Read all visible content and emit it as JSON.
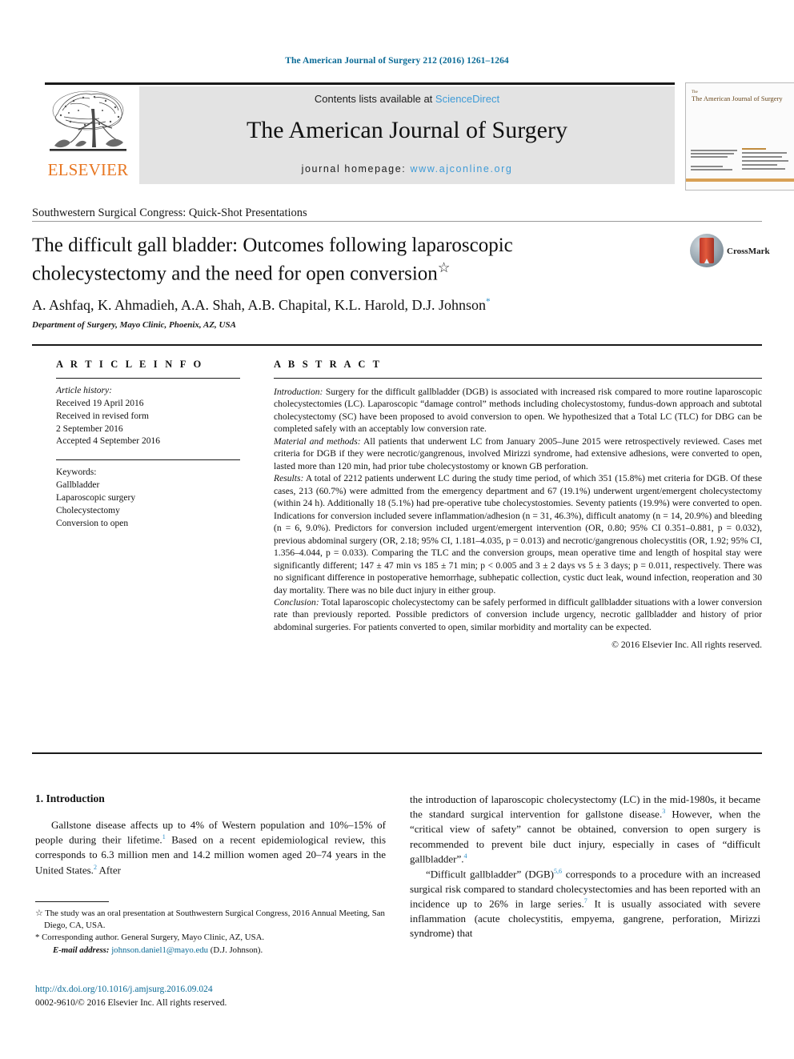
{
  "running_head": "The American Journal of Surgery 212 (2016) 1261–1264",
  "masthead": {
    "contents_prefix": "Contents lists available at ",
    "sciencedirect": "ScienceDirect",
    "journal_name": "The American Journal of Surgery",
    "homepage_prefix": "journal homepage: ",
    "homepage_url": "www.ajconline.org",
    "publisher": "ELSEVIER",
    "cover_title": "The American Journal of Surgery",
    "cover_title_small": "The"
  },
  "colors": {
    "running_head_blue": "#0a6a96",
    "link_blue": "#3f9bd7",
    "elsevier_orange": "#e87722",
    "panel_gray": "#e3e3e3",
    "sup_blue": "#2c8fc9"
  },
  "section_label": "Southwestern Surgical Congress: Quick-Shot Presentations",
  "title": "The difficult gall bladder: Outcomes following laparoscopic cholecystectomy and the need for open conversion",
  "title_marker": "☆",
  "authors": "A. Ashfaq, K. Ahmadieh, A.A. Shah, A.B. Chapital, K.L. Harold, D.J. Johnson",
  "authors_marker": "*",
  "affiliation": "Department of Surgery, Mayo Clinic, Phoenix, AZ, USA",
  "crossmark_label": "CrossMark",
  "article_info": {
    "heading": "A R T I C L E  I N F O",
    "history_label": "Article history:",
    "history": [
      "Received 19 April 2016",
      "Received in revised form",
      "2 September 2016",
      "Accepted 4 September 2016"
    ],
    "keywords_label": "Keywords:",
    "keywords": [
      "Gallbladder",
      "Laparoscopic surgery",
      "Cholecystectomy",
      "Conversion to open"
    ]
  },
  "abstract": {
    "heading": "A B S T R A C T",
    "introduction_label": "Introduction:",
    "introduction": " Surgery for the difficult gallbladder (DGB) is associated with increased risk compared to more routine laparoscopic cholecystectomies (LC). Laparoscopic “damage control” methods including cholecystostomy, fundus-down approach and subtotal cholecystectomy (SC) have been proposed to avoid conversion to open. We hypothesized that a Total LC (TLC) for DBG can be completed safely with an acceptably low conversion rate.",
    "methods_label": "Material and methods:",
    "methods": " All patients that underwent LC from January 2005–June 2015 were retrospectively reviewed. Cases met criteria for DGB if they were necrotic/gangrenous, involved Mirizzi syndrome, had extensive adhesions, were converted to open, lasted more than 120 min, had prior tube cholecystostomy or known GB perforation.",
    "results_label": "Results:",
    "results": " A total of 2212 patients underwent LC during the study time period, of which 351 (15.8%) met criteria for DGB. Of these cases, 213 (60.7%) were admitted from the emergency department and 67 (19.1%) underwent urgent/emergent cholecystectomy (within 24 h). Additionally 18 (5.1%) had pre-operative tube cholecystostomies. Seventy patients (19.9%) were converted to open. Indications for conversion included severe inflammation/adhesion (n = 31, 46.3%), difficult anatomy (n = 14, 20.9%) and bleeding (n = 6, 9.0%). Predictors for conversion included urgent/emergent intervention (OR, 0.80; 95% CI 0.351–0.881, p = 0.032), previous abdominal surgery (OR, 2.18; 95% CI, 1.181–4.035, p = 0.013) and necrotic/gangrenous cholecystitis (OR, 1.92; 95% CI, 1.356–4.044, p = 0.033). Comparing the TLC and the conversion groups, mean operative time and length of hospital stay were significantly different; 147 ± 47 min vs 185 ± 71 min; p < 0.005 and 3 ± 2 days vs 5 ± 3 days; p = 0.011, respectively. There was no significant difference in postoperative hemorrhage, subhepatic collection, cystic duct leak, wound infection, reoperation and 30 day mortality. There was no bile duct injury in either group.",
    "conclusion_label": "Conclusion:",
    "conclusion": " Total laparoscopic cholecystectomy can be safely performed in difficult gallbladder situations with a lower conversion rate than previously reported. Possible predictors of conversion include urgency, necrotic gallbladder and history of prior abdominal surgeries. For patients converted to open, similar morbidity and mortality can be expected.",
    "copyright": "© 2016 Elsevier Inc. All rights reserved."
  },
  "body": {
    "intro_heading": "1. Introduction",
    "left_para_1a": "Gallstone disease affects up to 4% of Western population and 10%–15% of people during their lifetime.",
    "left_ref_1": "1",
    "left_para_1b": " Based on a recent epidemiological review, this corresponds to 6.3 million men and 14.2 million women aged 20–74 years in the United States.",
    "left_ref_2": "2",
    "left_para_1c": " After",
    "right_para_1a": "the introduction of laparoscopic cholecystectomy (LC) in the mid-1980s, it became the standard surgical intervention for gallstone disease.",
    "right_ref_3": "3",
    "right_para_1b": " However, when the “critical view of safety” cannot be obtained, conversion to open surgery is recommended to prevent bile duct injury, especially in cases of “difficult gallbladder”.",
    "right_ref_4": "4",
    "right_para_2a": "“Difficult gallbladder” (DGB)",
    "right_ref_56": "5,6",
    "right_para_2b": " corresponds to a procedure with an increased surgical risk compared to standard cholecystectomies and has been reported with an incidence up to 26% in large series.",
    "right_ref_7": "7",
    "right_para_2c": " It is usually associated with severe inflammation (acute cholecystitis, empyema, gangrene, perforation, Mirizzi syndrome) that"
  },
  "footnotes": {
    "star_mark": "☆",
    "star_text": " The study was an oral presentation at Southwestern Surgical Congress, 2016 Annual Meeting, San Diego, CA, USA.",
    "corr_mark": "*",
    "corr_text": " Corresponding author. General Surgery, Mayo Clinic, AZ, USA.",
    "email_label": "E-mail address:",
    "email": "johnson.daniel1@mayo.edu",
    "email_suffix": " (D.J. Johnson).",
    "doi": "http://dx.doi.org/10.1016/j.amjsurg.2016.09.024",
    "issn_line": "0002-9610/© 2016 Elsevier Inc. All rights reserved."
  }
}
